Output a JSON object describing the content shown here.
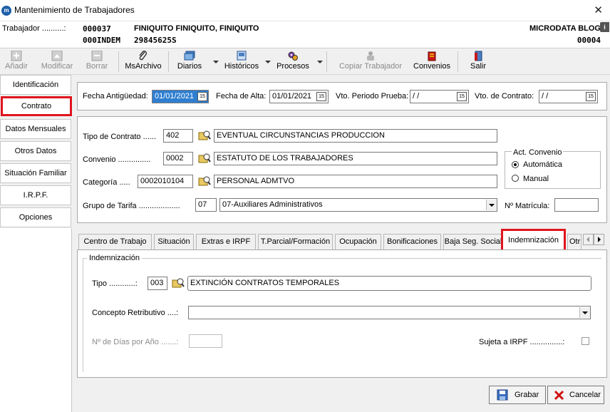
{
  "window": {
    "title": "Mantenimiento de Trabajadores",
    "close_glyph": "✕"
  },
  "header": {
    "label": "Trabajador ..........:",
    "code": "000037",
    "code2": "000INDEM",
    "name": "FINIQUITO FINIQUITO, FINIQUITO",
    "nif": "29845625S",
    "company": "MICRODATA BLOG",
    "company_code": "00004",
    "info_glyph": "i"
  },
  "toolbar": {
    "add": "Añadir",
    "modify": "Modificar",
    "delete": "Borrar",
    "msarchivo": "MsArchivo",
    "diarios": "Diarios",
    "historicos": "Históricos",
    "procesos": "Procesos",
    "copiar": "Copiar Trabajador",
    "convenios": "Convenios",
    "salir": "Salir"
  },
  "nav": [
    "Identificación",
    "Contrato",
    "Datos Mensuales",
    "Otros Datos",
    "Situación Familiar",
    "I.R.P.F.",
    "Opciones"
  ],
  "dates": {
    "antiguedad_label": "Fecha Antigüedad:",
    "antiguedad": "01/01/2021",
    "alta_label": "Fecha de Alta:",
    "alta": "01/01/2021",
    "prueba_label": "Vto. Periodo Prueba:",
    "prueba": " / /",
    "contrato_label": "Vto. de Contrato:",
    "contrato": " / /",
    "cal_glyph": "15"
  },
  "contract": {
    "tipo_label": "Tipo de Contrato ......",
    "tipo_code": "402",
    "tipo_desc": "EVENTUAL CIRCUNSTANCIAS PRODUCCION",
    "convenio_label": "Convenio ...............",
    "convenio_code": "0002",
    "convenio_desc": "ESTATUTO DE LOS TRABAJADORES",
    "categoria_label": "Categoría .....",
    "categoria_code": "0002010104",
    "categoria_desc": "PERSONAL ADMTVO",
    "grupo_label": "Grupo de Tarifa ...................",
    "grupo_code": "07",
    "grupo_desc": "07-Auxiliares Administrativos",
    "act_convenio_title": "Act. Convenio",
    "auto_label": "Automática",
    "manual_label": "Manual",
    "matricula_label": "Nº Matrícula:",
    "matricula": ""
  },
  "tabs": [
    "Centro de Trabajo",
    "Situación",
    "Extras e IRPF",
    "T.Parcial/Formación",
    "Ocupación",
    "Bonificaciones",
    "Baja Seg. Social",
    "Indemnización",
    "Otr"
  ],
  "indemnizacion": {
    "group_title": "Indemnización",
    "tipo_label": "Tipo ............:",
    "tipo_code": "003",
    "tipo_desc": "EXTINCIÓN CONTRATOS TEMPORALES",
    "concepto_label": "Concepto Retributivo ....:",
    "concepto": "",
    "dias_label": "Nº de Días por Año .......:",
    "dias": "",
    "sujeta_label": "Sujeta a IRPF ...............:"
  },
  "buttons": {
    "save": "Grabar",
    "cancel": "Cancelar"
  },
  "colors": {
    "highlight": "#e0141e",
    "selection": "#2f7fd0"
  }
}
